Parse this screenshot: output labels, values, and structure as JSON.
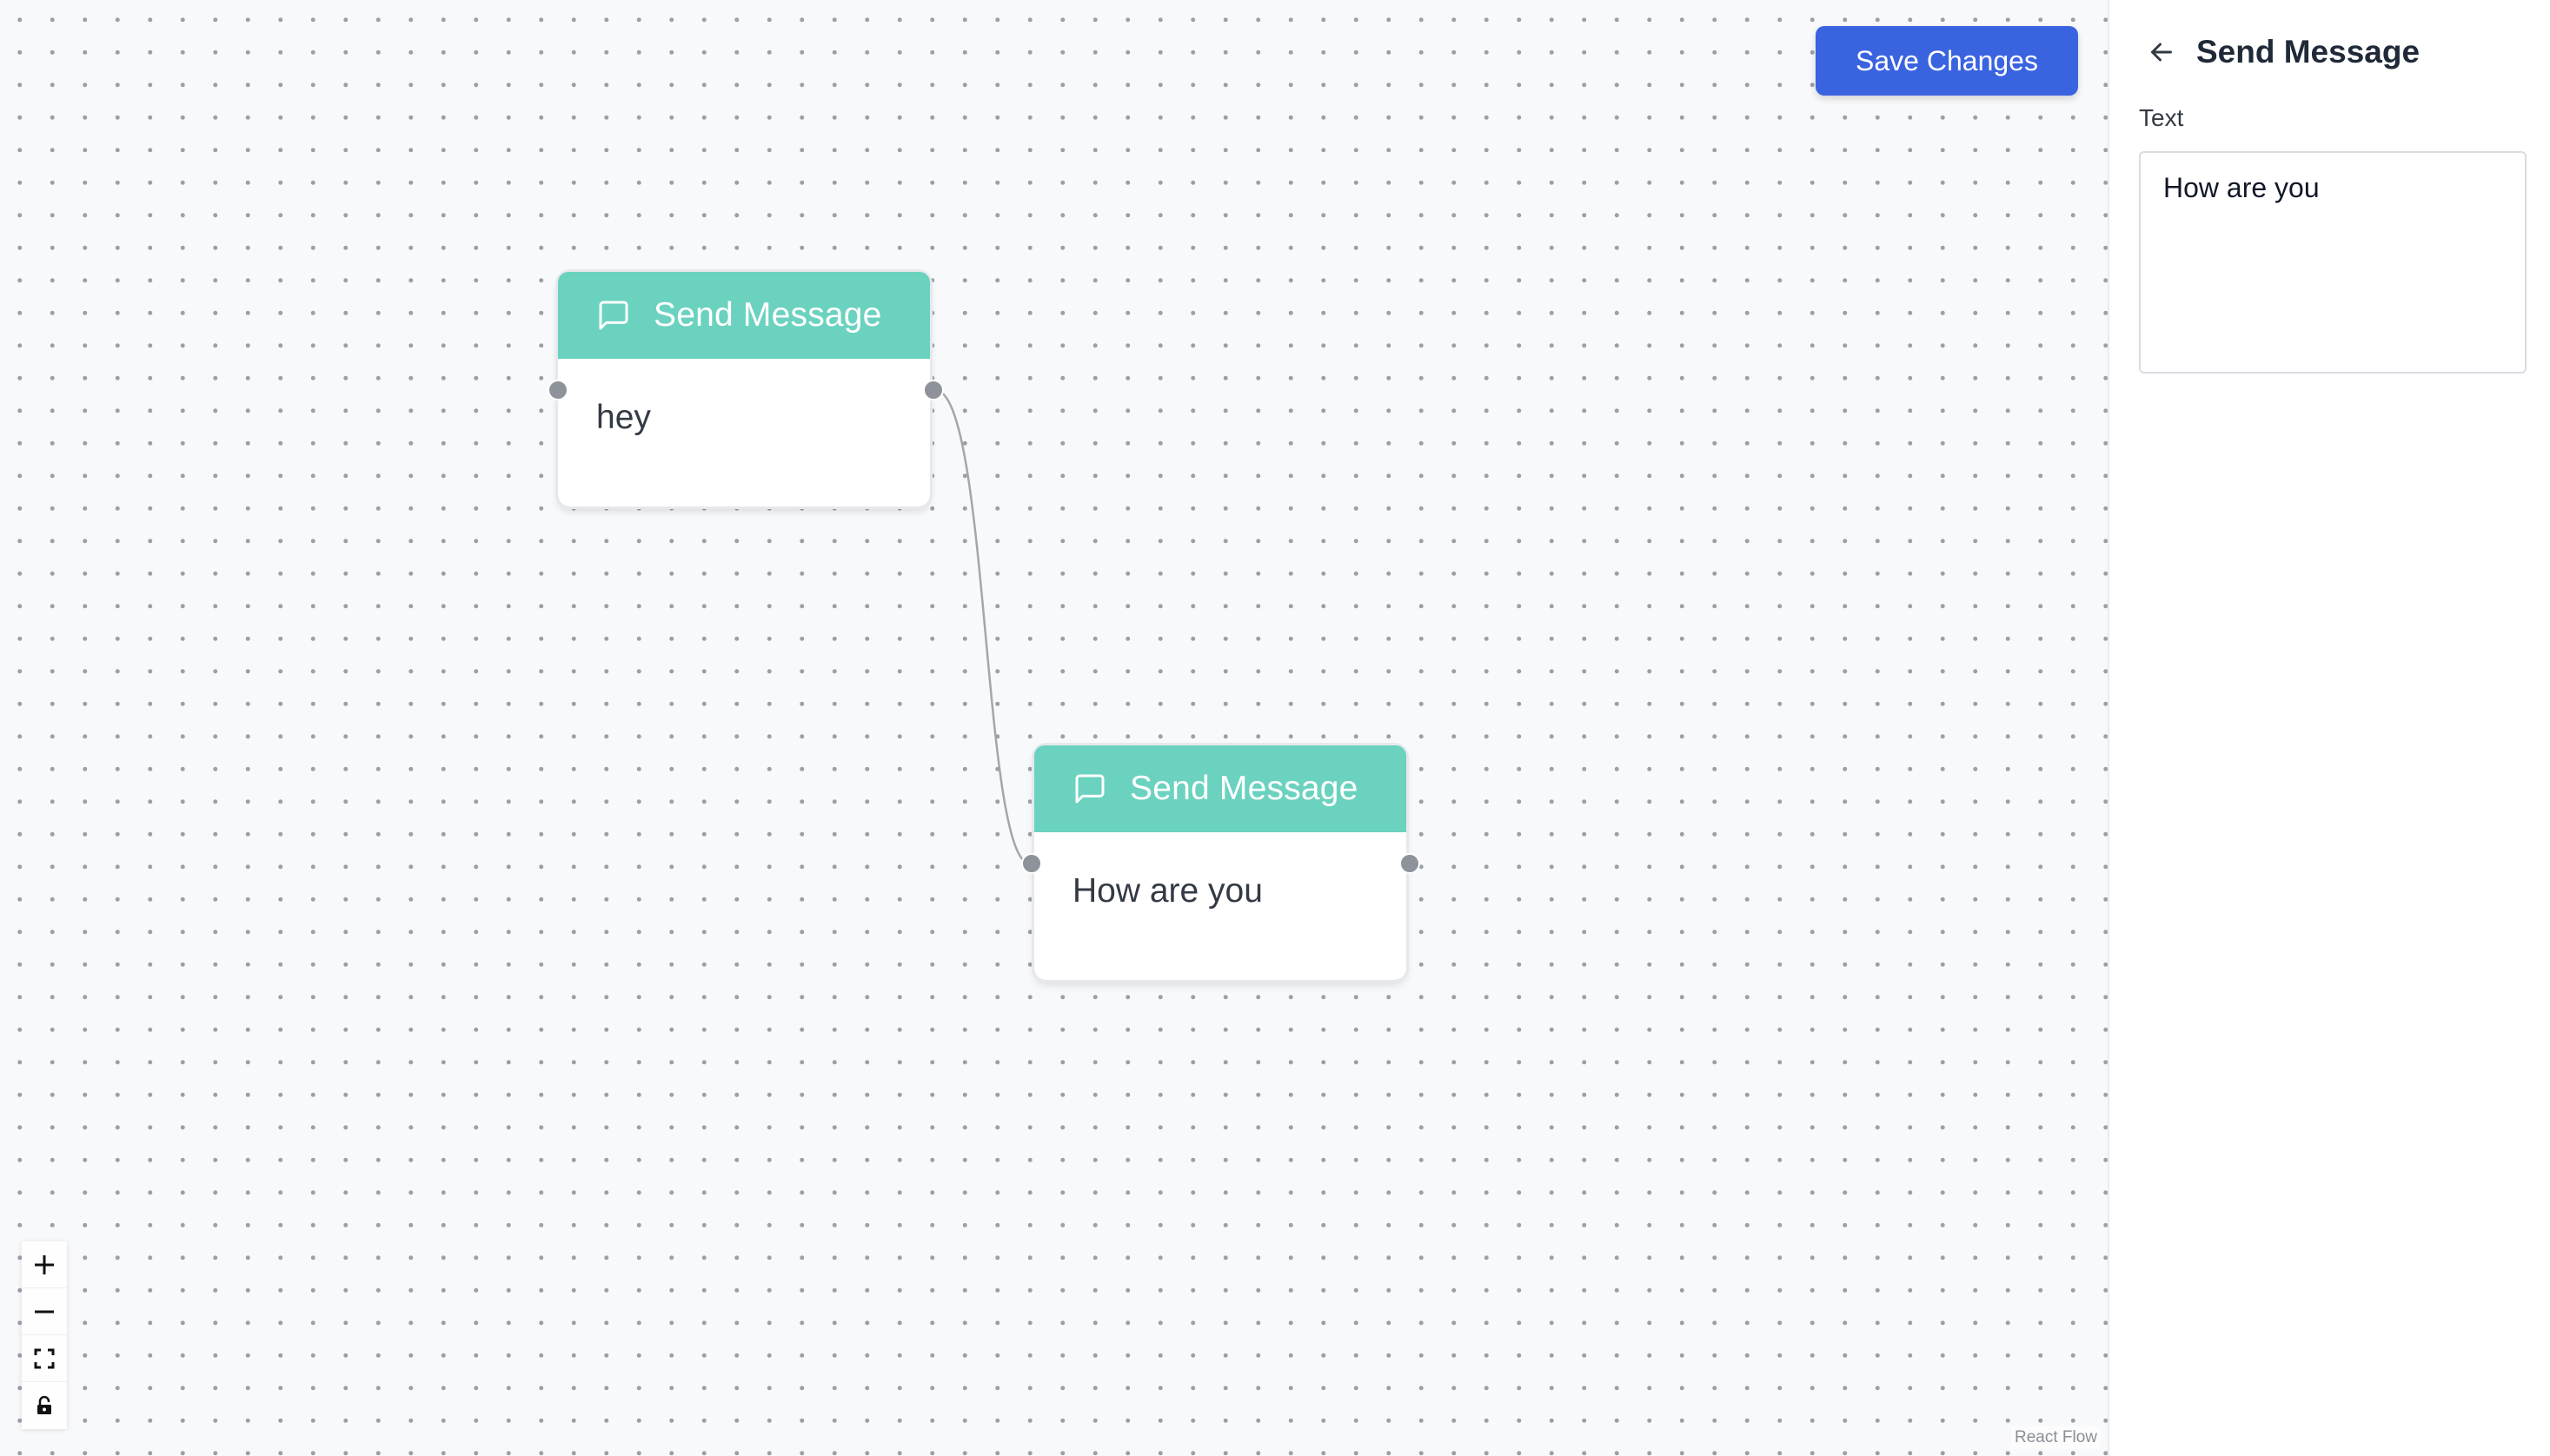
{
  "toolbar": {
    "save_label": "Save Changes"
  },
  "nodes": [
    {
      "title": "Send Message",
      "text": "hey",
      "icon": "message-square-icon"
    },
    {
      "title": "Send Message",
      "text": "How are you",
      "icon": "message-square-icon"
    }
  ],
  "controls": {
    "zoom_in_icon": "plus-icon",
    "zoom_out_icon": "minus-icon",
    "fit_view_icon": "fit-view-icon",
    "lock_icon": "lock-icon"
  },
  "attribution": "React Flow",
  "panel": {
    "title": "Send Message",
    "back_icon": "arrow-left-icon",
    "field_label": "Text",
    "text_value": "How are you"
  },
  "colors": {
    "node_header": "#6bd2bf",
    "primary_button": "#3a63e0",
    "handle": "#8e939b",
    "edge": "#a3a6ab"
  }
}
